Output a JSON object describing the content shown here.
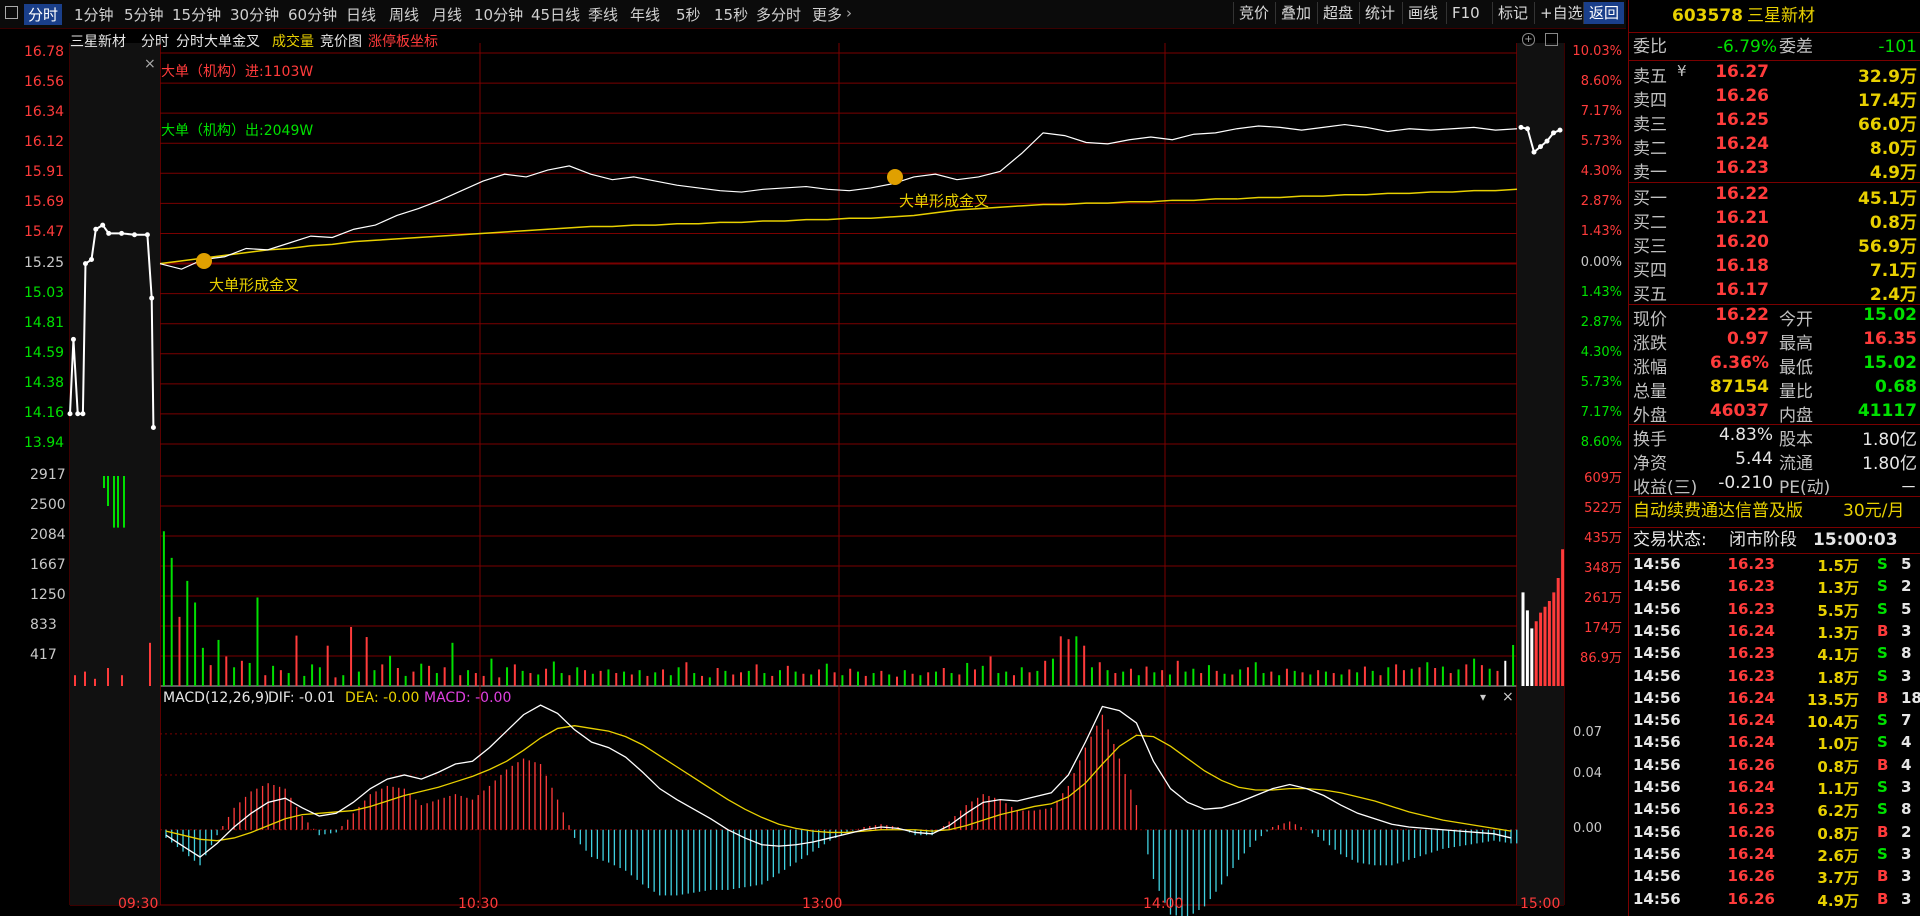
{
  "toolbar": {
    "periods": [
      "分时",
      "1分钟",
      "5分钟",
      "15分钟",
      "30分钟",
      "60分钟",
      "日线",
      "周线",
      "月线",
      "10分钟",
      "45日线",
      "季线",
      "年线",
      "5秒",
      "15秒",
      "多分时",
      "更多"
    ],
    "more_icon": "chevron-right-icon",
    "menu_icon": "menu-icon",
    "right_buttons": [
      "竞价",
      "叠加",
      "超盘",
      "统计",
      "画线",
      "F10",
      "标记",
      "+自选",
      "返回"
    ]
  },
  "chart_header": {
    "stock_name": "三星新材",
    "items": [
      "分时",
      "分时大单金叉",
      "成交量",
      "竞价图",
      "涨停板坐标"
    ],
    "close_icon": "close-icon"
  },
  "annotations": {
    "big_in": "大单（机构）进:1103W",
    "big_out": "大单（机构）出:2049W",
    "cross_label_1": "大单形成金叉",
    "cross_label_2": "大单形成金叉"
  },
  "macd_header": {
    "name": "MACD(12,26,9)",
    "dif": "DIF: -0.01",
    "dea": "DEA: -0.00",
    "macd": "MACD: -0.00"
  },
  "colors": {
    "up": "#ff3b3b",
    "down": "#00e000",
    "avg": "#e8d000",
    "price": "#ffffff",
    "grid": "#7a0000",
    "accent": "#1a3f8a"
  },
  "chart_data": [
    {
      "type": "line",
      "title": "分时",
      "x_ticks": [
        "09:30",
        "10:30",
        "13:00",
        "14:00",
        "15:00"
      ],
      "y_ticks_left": [
        "16.78",
        "16.56",
        "16.34",
        "16.12",
        "15.91",
        "15.69",
        "15.47",
        "15.25",
        "15.03",
        "14.81",
        "14.59",
        "14.38",
        "14.16",
        "13.94"
      ],
      "y_ticks_right": [
        "10.03%",
        "8.60%",
        "7.17%",
        "5.73%",
        "4.30%",
        "2.87%",
        "1.43%",
        "0.00%",
        "1.43%",
        "2.87%",
        "4.30%",
        "5.73%",
        "7.17%",
        "8.60%"
      ],
      "ylim": [
        13.94,
        16.78
      ],
      "prev_close": 15.25,
      "preauction": [
        [
          0,
          14.16
        ],
        [
          0.04,
          14.7
        ],
        [
          0.09,
          14.16
        ],
        [
          0.15,
          14.16
        ],
        [
          0.18,
          15.25
        ],
        [
          0.25,
          15.28
        ],
        [
          0.3,
          15.5
        ],
        [
          0.38,
          15.53
        ],
        [
          0.45,
          15.47
        ],
        [
          0.6,
          15.47
        ],
        [
          0.75,
          15.46
        ],
        [
          0.9,
          15.46
        ],
        [
          0.95,
          15.0
        ],
        [
          0.97,
          14.06
        ]
      ],
      "series": [
        {
          "values": [
            15.25,
            15.21,
            15.28,
            15.3,
            15.36,
            15.35,
            15.4,
            15.45,
            15.44,
            15.5,
            15.53,
            15.6,
            15.65,
            15.71,
            15.78,
            15.85,
            15.9,
            15.88,
            15.93,
            15.96,
            15.9,
            15.86,
            15.88,
            15.85,
            15.82,
            15.8,
            15.78,
            15.77,
            15.79,
            15.8,
            15.81,
            15.79,
            15.78,
            15.8,
            15.83,
            15.88,
            15.9,
            15.86,
            15.88,
            15.92,
            16.05,
            16.2,
            16.18,
            16.13,
            16.12,
            16.15,
            16.17,
            16.15,
            16.19,
            16.2,
            16.23,
            16.25,
            16.24,
            16.22,
            16.24,
            16.26,
            16.24,
            16.21,
            16.23,
            16.22,
            16.23,
            16.24,
            16.22,
            16.23
          ]
        },
        {
          "values": [
            15.25,
            15.27,
            15.29,
            15.31,
            15.33,
            15.35,
            15.36,
            15.38,
            15.39,
            15.41,
            15.42,
            15.43,
            15.44,
            15.45,
            15.46,
            15.47,
            15.48,
            15.49,
            15.5,
            15.51,
            15.52,
            15.52,
            15.53,
            15.53,
            15.54,
            15.54,
            15.55,
            15.55,
            15.56,
            15.56,
            15.57,
            15.57,
            15.58,
            15.58,
            15.59,
            15.6,
            15.62,
            15.64,
            15.65,
            15.66,
            15.67,
            15.68,
            15.68,
            15.69,
            15.69,
            15.7,
            15.7,
            15.71,
            15.71,
            15.72,
            15.72,
            15.73,
            15.73,
            15.74,
            15.74,
            15.75,
            15.75,
            15.76,
            15.76,
            15.77,
            15.77,
            15.78,
            15.78,
            15.79
          ]
        }
      ],
      "closing_auction": [
        16.24,
        16.23,
        16.06,
        16.1,
        16.14,
        16.2,
        16.22
      ]
    },
    {
      "type": "bar",
      "title": "成交量",
      "y_ticks_left": [
        "2917",
        "2500",
        "2084",
        "1667",
        "1250",
        "833",
        "417"
      ],
      "y_ticks_right": [
        "609万",
        "522万",
        "435万",
        "348万",
        "261万",
        "174万",
        "86.9万"
      ],
      "ylim": [
        0,
        2917
      ],
      "values": [
        2150,
        1780,
        960,
        1460,
        1160,
        530,
        290,
        640,
        410,
        260,
        350,
        320,
        1230,
        150,
        280,
        220,
        180,
        700,
        140,
        300,
        260,
        560,
        120,
        150,
        820,
        200,
        680,
        220,
        300,
        420,
        250,
        140,
        200,
        310,
        280,
        180,
        260,
        600,
        150,
        220,
        180,
        140,
        380,
        120,
        260,
        300,
        210,
        180,
        160,
        240,
        340,
        180,
        150,
        260,
        220,
        170,
        210,
        230,
        180,
        200,
        160,
        220,
        140,
        190,
        230,
        150,
        260,
        330,
        180,
        140,
        120,
        250,
        210,
        160,
        190,
        210,
        300,
        180,
        140,
        220,
        280,
        200,
        170,
        160,
        230,
        310,
        190,
        150,
        240,
        200,
        140,
        180,
        210,
        160,
        130,
        220,
        170,
        150,
        190,
        200,
        250,
        180,
        160,
        320,
        230,
        280,
        410,
        180,
        200,
        150,
        260,
        190,
        210,
        350,
        380,
        690,
        650,
        690,
        560,
        260,
        330,
        220,
        180,
        200,
        240,
        150,
        270,
        190,
        220,
        160,
        350,
        200,
        240,
        180,
        290,
        210,
        170,
        160,
        230,
        260,
        330,
        180,
        200,
        150,
        240,
        210,
        190,
        160,
        220,
        200,
        180,
        160,
        230,
        190,
        270,
        210,
        150,
        260,
        300,
        220,
        240,
        260,
        330,
        250,
        270,
        180,
        230,
        300,
        380,
        290,
        240,
        210,
        350,
        570
      ],
      "colors": "ggrgggrgrgrggrgrgrgggrrgrgrgrgrgrgrgrgrgrrgrgrgrgrggrgrgrgrgrgrgrggrgrgrgrrgrgrgrgrgrgrgrgrgrgrgrgrgrgrgrgrggrgrgrgrrgrgrgrgrgrgrgrggrgrgrgrggrgrgrgrgrgrgrgrgrrgrgrgrgrgrgrwgwgwgrg",
      "closing_values": [
        1300,
        1050,
        800,
        900,
        1020,
        1100,
        1180,
        1300,
        1500,
        1900
      ]
    },
    {
      "type": "bar",
      "title": "MACD(12,26,9)",
      "y_ticks_right": [
        "0.07",
        "0.04",
        "0.00"
      ],
      "ylim": [
        -0.055,
        0.105
      ],
      "series": [
        {
          "name": "DIF",
          "values": [
            -0.004,
            -0.012,
            -0.02,
            -0.01,
            0.002,
            0.012,
            0.02,
            0.023,
            0.016,
            0.01,
            0.012,
            0.02,
            0.03,
            0.037,
            0.04,
            0.037,
            0.042,
            0.048,
            0.05,
            0.06,
            0.072,
            0.084,
            0.091,
            0.085,
            0.073,
            0.064,
            0.06,
            0.053,
            0.042,
            0.03,
            0.022,
            0.015,
            0.008,
            0,
            -0.006,
            -0.011,
            -0.012,
            -0.011,
            -0.009,
            -0.006,
            -0.003,
            0,
            0.002,
            0.001,
            -0.002,
            -0.003,
            0.003,
            0.012,
            0.02,
            0.022,
            0.021,
            0.024,
            0.027,
            0.04,
            0.064,
            0.09,
            0.087,
            0.078,
            0.05,
            0.03,
            0.02,
            0.015,
            0.016,
            0.02,
            0.025,
            0.03,
            0.033,
            0.03,
            0.025,
            0.018,
            0.012,
            0.008,
            0.004,
            0.002,
            0.001,
            0,
            -0.001,
            -0.002,
            -0.003,
            -0.006
          ]
        },
        {
          "name": "DEA",
          "values": [
            -0.001,
            -0.004,
            -0.007,
            -0.008,
            -0.006,
            -0.002,
            0.003,
            0.008,
            0.011,
            0.012,
            0.013,
            0.014,
            0.017,
            0.021,
            0.025,
            0.028,
            0.031,
            0.035,
            0.039,
            0.044,
            0.05,
            0.058,
            0.067,
            0.074,
            0.076,
            0.074,
            0.072,
            0.068,
            0.062,
            0.054,
            0.046,
            0.038,
            0.03,
            0.022,
            0.015,
            0.009,
            0.004,
            0.001,
            -0.001,
            -0.002,
            -0.002,
            -0.001,
            0,
            0,
            0,
            -0.001,
            0,
            0.003,
            0.007,
            0.011,
            0.014,
            0.017,
            0.019,
            0.024,
            0.034,
            0.048,
            0.061,
            0.069,
            0.068,
            0.061,
            0.052,
            0.043,
            0.036,
            0.031,
            0.029,
            0.029,
            0.03,
            0.03,
            0.029,
            0.027,
            0.024,
            0.021,
            0.017,
            0.013,
            0.01,
            0.007,
            0.005,
            0.003,
            0.001,
            -0.001
          ]
        },
        {
          "name": "MACD",
          "values": [
            -0.006,
            -0.016,
            -0.026,
            -0.004,
            0.016,
            0.028,
            0.034,
            0.03,
            0.01,
            -0.004,
            -0.002,
            0.012,
            0.026,
            0.032,
            0.03,
            0.018,
            0.022,
            0.026,
            0.022,
            0.032,
            0.044,
            0.052,
            0.048,
            0.022,
            -0.006,
            -0.02,
            -0.024,
            -0.03,
            -0.04,
            -0.048,
            -0.048,
            -0.046,
            -0.044,
            -0.044,
            -0.042,
            -0.04,
            -0.032,
            -0.024,
            -0.016,
            -0.008,
            -0.002,
            0.002,
            0.004,
            0.002,
            -0.004,
            -0.004,
            0.006,
            0.018,
            0.026,
            0.022,
            0.014,
            0.014,
            0.016,
            0.032,
            0.06,
            0.084,
            0.052,
            0.018,
            -0.036,
            -0.062,
            -0.064,
            -0.056,
            -0.04,
            -0.022,
            -0.008,
            0.002,
            0.006,
            0,
            -0.008,
            -0.018,
            -0.024,
            -0.026,
            -0.026,
            -0.022,
            -0.018,
            -0.014,
            -0.012,
            -0.01,
            -0.008,
            -0.01
          ]
        }
      ]
    }
  ],
  "quote": {
    "code": "603578",
    "name": "三星新材",
    "weibi_label": "委比",
    "weibi": "-6.79%",
    "weicha_label": "委差",
    "weicha": "-101",
    "asks": [
      {
        "label": "卖五",
        "price": "16.27",
        "vol": "32.9万",
        "flag": "¥"
      },
      {
        "label": "卖四",
        "price": "16.26",
        "vol": "17.4万"
      },
      {
        "label": "卖三",
        "price": "16.25",
        "vol": "66.0万"
      },
      {
        "label": "卖二",
        "price": "16.24",
        "vol": "8.0万"
      },
      {
        "label": "卖一",
        "price": "16.23",
        "vol": "4.9万"
      }
    ],
    "bids": [
      {
        "label": "买一",
        "price": "16.22",
        "vol": "45.1万"
      },
      {
        "label": "买二",
        "price": "16.21",
        "vol": "0.8万"
      },
      {
        "label": "买三",
        "price": "16.20",
        "vol": "56.9万"
      },
      {
        "label": "买四",
        "price": "16.18",
        "vol": "7.1万"
      },
      {
        "label": "买五",
        "price": "16.17",
        "vol": "2.4万"
      }
    ],
    "stats": [
      {
        "l1": "现价",
        "v1": "16.22",
        "c1": "red",
        "l2": "今开",
        "v2": "15.02",
        "c2": "green"
      },
      {
        "l1": "涨跌",
        "v1": "0.97",
        "c1": "red",
        "l2": "最高",
        "v2": "16.35",
        "c2": "red"
      },
      {
        "l1": "涨幅",
        "v1": "6.36%",
        "c1": "red",
        "l2": "最低",
        "v2": "15.02",
        "c2": "green"
      },
      {
        "l1": "总量",
        "v1": "87154",
        "c1": "yellow",
        "l2": "量比",
        "v2": "0.68",
        "c2": "green"
      },
      {
        "l1": "外盘",
        "v1": "46037",
        "c1": "red",
        "l2": "内盘",
        "v2": "41117",
        "c2": "green"
      }
    ],
    "fund": [
      {
        "l1": "换手",
        "v1": "4.83%",
        "l2": "股本",
        "v2": "1.80亿"
      },
      {
        "l1": "净资",
        "v1": "5.44",
        "l2": "流通",
        "v2": "1.80亿"
      },
      {
        "l1": "收益(三)",
        "v1": "-0.210",
        "l2": "PE(动)",
        "v2": "－"
      }
    ],
    "promo": "自动续费通达信普及版",
    "promo_price": "30元/月",
    "status_label": "交易状态:",
    "status": "闭市阶段",
    "status_time": "15:00:03",
    "ticks": [
      {
        "t": "14:56",
        "p": "16.23",
        "v": "1.5万",
        "s": "S",
        "n": "5"
      },
      {
        "t": "14:56",
        "p": "16.23",
        "v": "1.3万",
        "s": "S",
        "n": "2"
      },
      {
        "t": "14:56",
        "p": "16.23",
        "v": "5.5万",
        "s": "S",
        "n": "5"
      },
      {
        "t": "14:56",
        "p": "16.24",
        "v": "1.3万",
        "s": "B",
        "n": "3"
      },
      {
        "t": "14:56",
        "p": "16.23",
        "v": "4.1万",
        "s": "S",
        "n": "8"
      },
      {
        "t": "14:56",
        "p": "16.23",
        "v": "1.8万",
        "s": "S",
        "n": "3"
      },
      {
        "t": "14:56",
        "p": "16.24",
        "v": "13.5万",
        "s": "B",
        "n": "18"
      },
      {
        "t": "14:56",
        "p": "16.24",
        "v": "10.4万",
        "s": "S",
        "n": "7"
      },
      {
        "t": "14:56",
        "p": "16.24",
        "v": "1.0万",
        "s": "S",
        "n": "4"
      },
      {
        "t": "14:56",
        "p": "16.26",
        "v": "0.8万",
        "s": "B",
        "n": "4"
      },
      {
        "t": "14:56",
        "p": "16.24",
        "v": "1.1万",
        "s": "S",
        "n": "3"
      },
      {
        "t": "14:56",
        "p": "16.23",
        "v": "6.2万",
        "s": "S",
        "n": "8"
      },
      {
        "t": "14:56",
        "p": "16.26",
        "v": "0.8万",
        "s": "B",
        "n": "2"
      },
      {
        "t": "14:56",
        "p": "16.24",
        "v": "2.6万",
        "s": "S",
        "n": "3"
      },
      {
        "t": "14:56",
        "p": "16.26",
        "v": "3.7万",
        "s": "B",
        "n": "3"
      },
      {
        "t": "14:56",
        "p": "16.26",
        "v": "4.9万",
        "s": "B",
        "n": "3"
      }
    ]
  }
}
